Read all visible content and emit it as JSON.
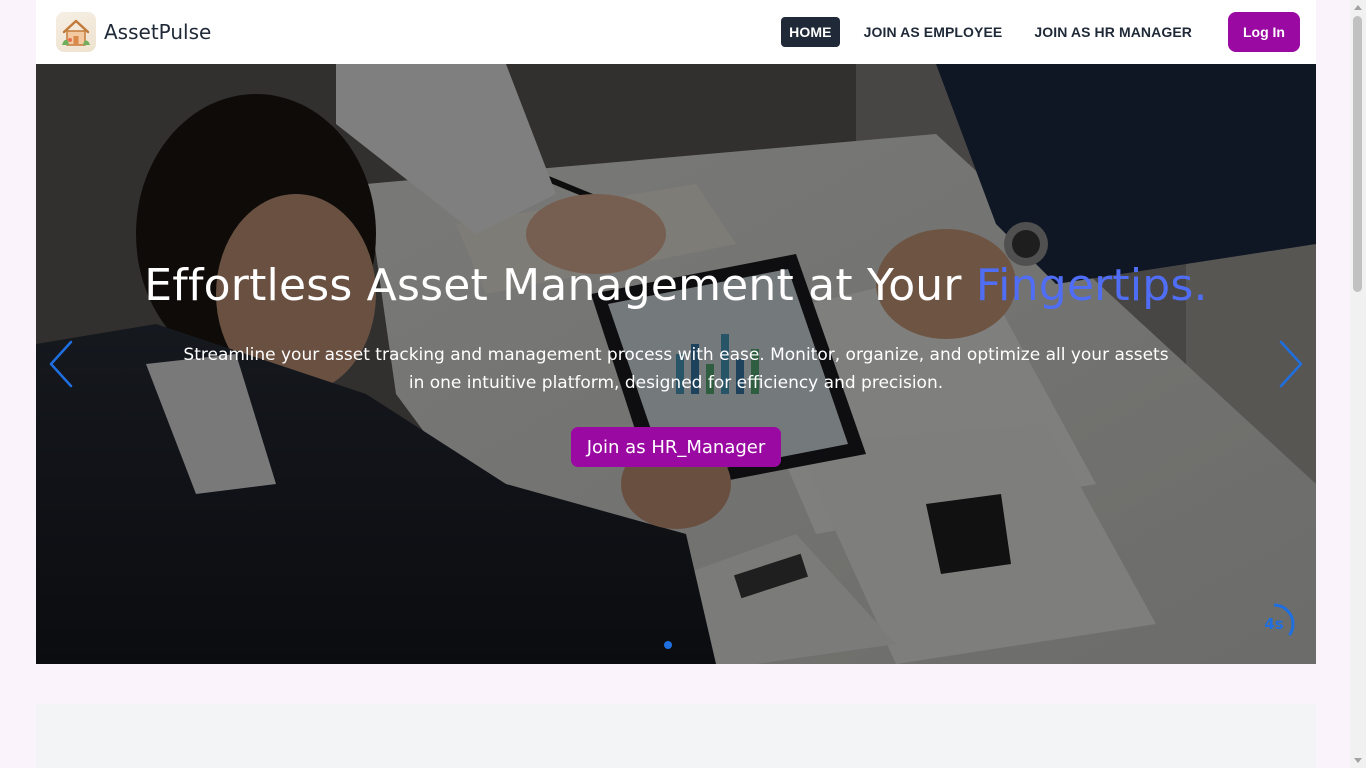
{
  "brand": {
    "name": "AssetPulse",
    "logo_icon": "house-logo-icon"
  },
  "nav": {
    "links": [
      {
        "label": "HOME",
        "active": true
      },
      {
        "label": "JOIN AS EMPLOYEE",
        "active": false
      },
      {
        "label": "JOIN AS HR MANAGER",
        "active": false
      }
    ],
    "login_label": "Log In"
  },
  "hero": {
    "title_main": "Effortless Asset Management at Your",
    "title_accent": "Fingertips.",
    "subtitle": "Streamline your asset tracking and management process with ease. Monitor, organize, and optimize all your assets in one intuitive platform, designed for efficiency and precision.",
    "cta_label": "Join as HR_Manager",
    "prev_icon": "chevron-left-icon",
    "next_icon": "chevron-right-icon",
    "autoplay_label": "4s",
    "autoplay_progress": 0.35,
    "slide_count": 1,
    "active_slide": 1
  },
  "colors": {
    "accent": "#9a0aa2",
    "title_accent": "#4f6df5",
    "carousel_blue": "#1f6fe0",
    "nav_dark": "#1f2937",
    "page_bg": "#fbf3fb"
  }
}
